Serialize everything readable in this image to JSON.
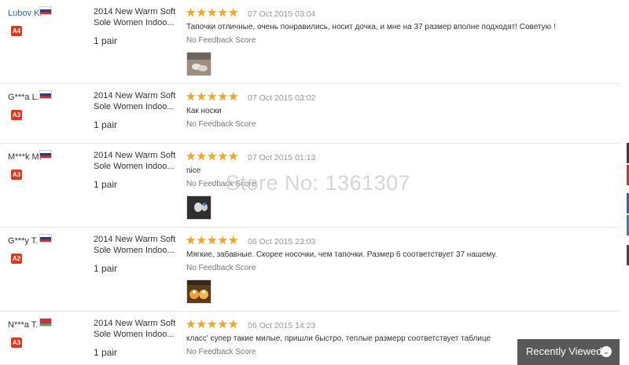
{
  "reviews": [
    {
      "user": "Lubov K.",
      "user_is_link": true,
      "flag": "russia",
      "level": "A4",
      "product": "2014 New Warm Soft Sole Women Indoo...",
      "quantity": "1 pair",
      "rating": 5,
      "date": "07 Oct 2015 03:04",
      "text": "Тапочки отличные, очень понравились, носит дочка, и мне на 37 размер вполне подходят! Советую !",
      "feedback_label": "No Feedback Score",
      "has_photo": true
    },
    {
      "user": "G***a L.",
      "user_is_link": false,
      "flag": "russia",
      "level": "A3",
      "product": "2014 New Warm Soft Sole Women Indoo...",
      "quantity": "1 pair",
      "rating": 5,
      "date": "07 Oct 2015 03:02",
      "text": "Как носки",
      "feedback_label": "No Feedback Score",
      "has_photo": false
    },
    {
      "user": "M***k M.",
      "user_is_link": false,
      "flag": "russia",
      "level": "A3",
      "product": "2014 New Warm Soft Sole Women Indoo...",
      "quantity": "1 pair",
      "rating": 5,
      "date": "07 Oct 2015 01:13",
      "text": "nice",
      "feedback_label": "No Feedback Score",
      "has_photo": true
    },
    {
      "user": "G***y T.",
      "user_is_link": false,
      "flag": "russia",
      "level": "A2",
      "product": "2014 New Warm Soft Sole Women Indoo...",
      "quantity": "1 pair",
      "rating": 5,
      "date": "06 Oct 2015 23:03",
      "text": "Мягкие, забавные. Скорее носочки, чем тапочки. Размер 6 соответствует 37 нашему.",
      "feedback_label": "No Feedback Score",
      "has_photo": true
    },
    {
      "user": "N***a T.",
      "user_is_link": false,
      "flag": "belarus",
      "level": "A3",
      "product": "2014 New Warm Soft Sole Women Indoo...",
      "quantity": "1 pair",
      "rating": 5,
      "date": "06 Oct 2015 14:23",
      "text": "класс' супер такие милые, пришли быстро, теплые размерр соответствует таблице",
      "feedback_label": "No Feedback Score",
      "has_photo": false
    }
  ],
  "watermark": "Store No: 1361307",
  "recently_viewed": {
    "label": "Recently Viewed",
    "icon": "chevron-down-icon"
  },
  "colors": {
    "star": "#f5a623",
    "badge": "#e5361b",
    "link": "#2266cc",
    "recently_viewed_bg": "#595959"
  }
}
